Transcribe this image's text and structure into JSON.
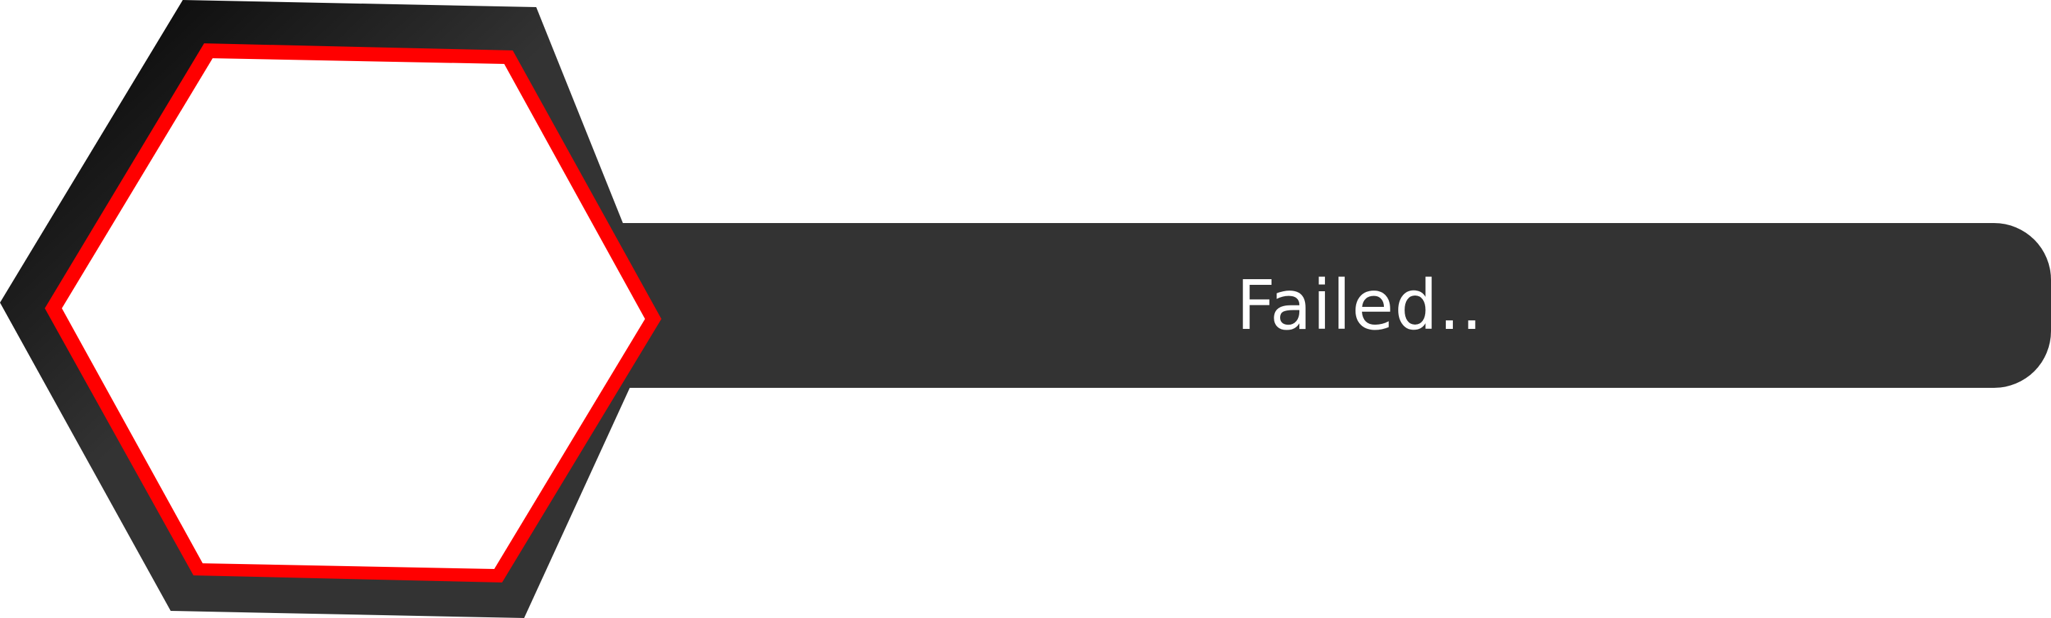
{
  "status": {
    "message": "Failed.."
  },
  "colors": {
    "banner": "#333333",
    "outer_dark": "#000000",
    "outer_light": "#333333",
    "outline": "#ff0000",
    "inner_fill": "#ffffff",
    "text": "#ffffff"
  }
}
